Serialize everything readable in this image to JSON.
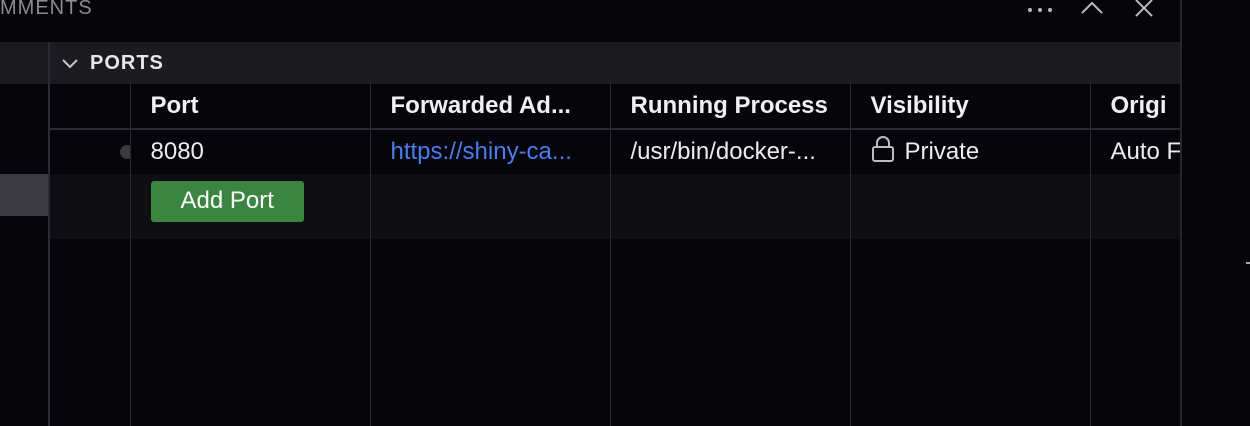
{
  "panel": {
    "title": "MMENTS"
  },
  "top_actions": [
    {
      "name": "more-actions",
      "icon": "more-icon"
    },
    {
      "name": "maximize",
      "icon": "chevron-up-icon"
    },
    {
      "name": "close",
      "icon": "close-icon"
    }
  ],
  "section": {
    "title": "PORTS"
  },
  "table": {
    "headers": [
      "",
      "Port",
      "Forwarded Ad...",
      "Running Process",
      "Visibility",
      "Origi"
    ],
    "rows": [
      {
        "port": "8080",
        "forwarded_address": "https://shiny-ca...",
        "running_process": "/usr/bin/docker-...",
        "visibility": "Private",
        "origin": "Auto F"
      }
    ],
    "add_port_label": "Add Port"
  },
  "colors": {
    "background": "#05050a",
    "header_bg": "#1b1b20",
    "link": "#4a7df0",
    "button": "#3b8541"
  }
}
